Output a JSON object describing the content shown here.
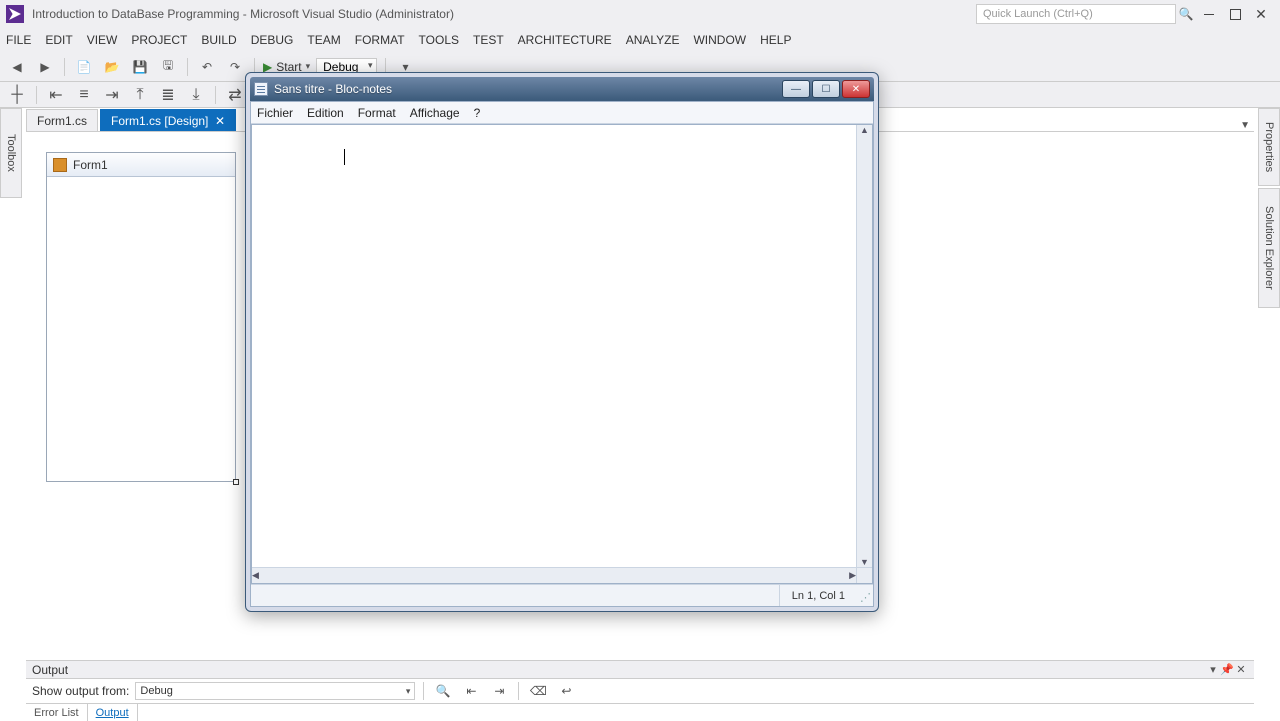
{
  "vs": {
    "title": "Introduction to DataBase Programming - Microsoft Visual Studio (Administrator)",
    "quick_launch_placeholder": "Quick Launch (Ctrl+Q)",
    "menu": [
      "FILE",
      "EDIT",
      "VIEW",
      "PROJECT",
      "BUILD",
      "DEBUG",
      "TEAM",
      "FORMAT",
      "TOOLS",
      "TEST",
      "ARCHITECTURE",
      "ANALYZE",
      "WINDOW",
      "HELP"
    ],
    "start_label": "Start",
    "config_label": "Debug",
    "tabs": {
      "inactive": "Form1.cs",
      "active": "Form1.cs [Design]"
    },
    "side_left": "Toolbox",
    "side_right_top": "Properties",
    "side_right_bottom": "Solution Explorer",
    "form_title": "Form1",
    "output": {
      "title": "Output",
      "show_from_label": "Show output from:",
      "show_from_value": "Debug",
      "tab_errorlist": "Error List",
      "tab_output": "Output"
    }
  },
  "notepad": {
    "title": "Sans titre - Bloc-notes",
    "menu": [
      "Fichier",
      "Edition",
      "Format",
      "Affichage",
      "?"
    ],
    "text": "",
    "status": "Ln 1, Col 1"
  }
}
